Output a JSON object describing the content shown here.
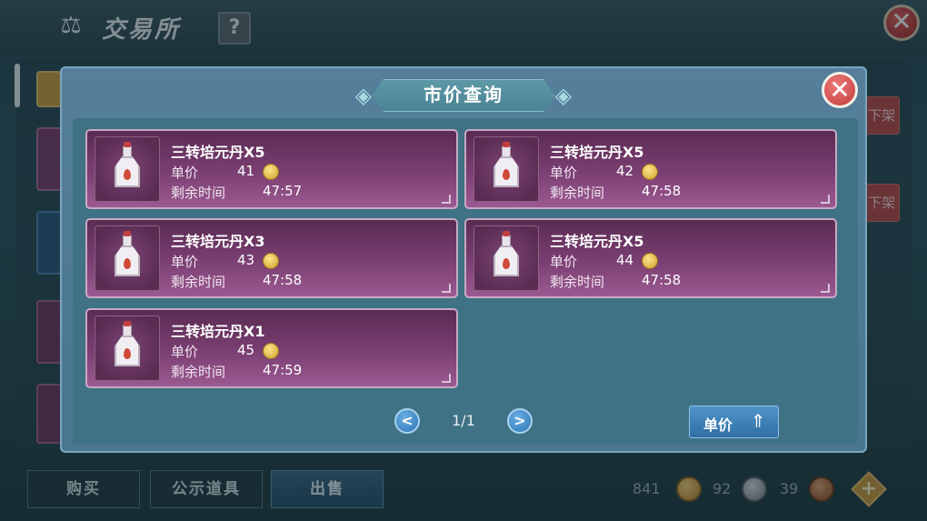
{
  "window": {
    "title": "交易所",
    "help_label": "?",
    "close_label": "✕"
  },
  "side_actions": {
    "delist_label": "下架"
  },
  "tabs": [
    {
      "label": "购买"
    },
    {
      "label": "公示道具"
    },
    {
      "label": "出售"
    }
  ],
  "currency": {
    "gold": "841",
    "silver": "92",
    "bronze": "39",
    "add_label": "+"
  },
  "modal": {
    "title": "市价查询",
    "close_label": "✕",
    "listings": [
      {
        "name": "三转培元丹X5",
        "price_label": "单价",
        "price": "41",
        "time_label": "剩余时间",
        "time": "47:57"
      },
      {
        "name": "三转培元丹X5",
        "price_label": "单价",
        "price": "42",
        "time_label": "剩余时间",
        "time": "47:58"
      },
      {
        "name": "三转培元丹X3",
        "price_label": "单价",
        "price": "43",
        "time_label": "剩余时间",
        "time": "47:58"
      },
      {
        "name": "三转培元丹X5",
        "price_label": "单价",
        "price": "44",
        "time_label": "剩余时间",
        "time": "47:58"
      },
      {
        "name": "三转培元丹X1",
        "price_label": "单价",
        "price": "45",
        "time_label": "剩余时间",
        "time": "47:59"
      }
    ],
    "pager": {
      "page": "1/1",
      "prev_label": "<",
      "next_label": ">"
    },
    "sort": {
      "label": "单价",
      "icon": "sort-up-icon"
    }
  },
  "colors": {
    "accent": "#4f95c8",
    "card_bg": "#7b3f73",
    "close_red": "#c23a3a",
    "coin_gold": "#d0a02a"
  }
}
